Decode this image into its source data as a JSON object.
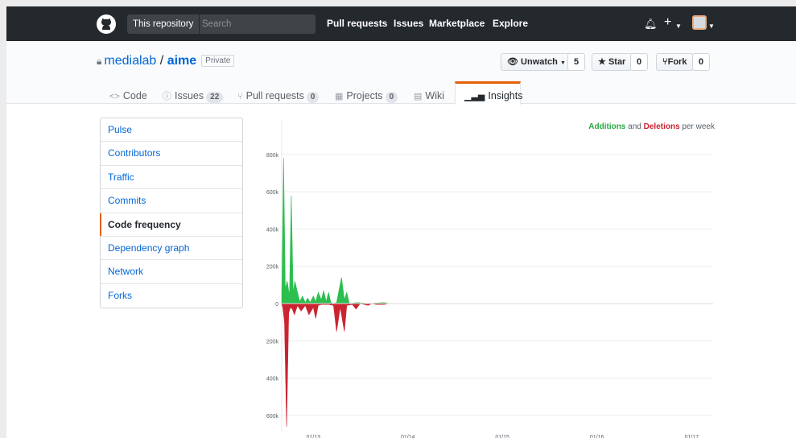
{
  "header": {
    "search_scope": "This repository",
    "search_placeholder": "Search",
    "nav": [
      "Pull requests",
      "Issues",
      "Marketplace",
      "Explore"
    ]
  },
  "repo": {
    "owner": "medialab",
    "separator": "/",
    "name": "aime",
    "visibility": "Private",
    "unwatch_label": "Unwatch",
    "watch_count": "5",
    "star_label": "Star",
    "star_count": "0",
    "fork_label": "Fork",
    "fork_count": "0"
  },
  "tabs": [
    {
      "label": "Code",
      "count": ""
    },
    {
      "label": "Issues",
      "count": "22"
    },
    {
      "label": "Pull requests",
      "count": "0"
    },
    {
      "label": "Projects",
      "count": "0"
    },
    {
      "label": "Wiki",
      "count": ""
    },
    {
      "label": "Insights",
      "count": "",
      "active": true
    }
  ],
  "sidebar": {
    "items": [
      "Pulse",
      "Contributors",
      "Traffic",
      "Commits",
      "Code frequency",
      "Dependency graph",
      "Network",
      "Forks"
    ],
    "selected": "Code frequency"
  },
  "legend": {
    "additions": "Additions",
    "and": "and",
    "deletions": "Deletions",
    "suffix": "per week"
  },
  "colors": {
    "additions": "#2cbe4e",
    "deletions": "#cb2431",
    "accent": "#e36209",
    "link": "#0366d6"
  },
  "chart_data": {
    "type": "area",
    "ytick_labels": [
      "800k",
      "600k",
      "400k",
      "200k",
      "0",
      "200k",
      "400k",
      "600k"
    ],
    "ytick_values": [
      800000,
      600000,
      400000,
      200000,
      0,
      -200000,
      -400000,
      -600000
    ],
    "xtick_labels": [
      "01/13",
      "01/14",
      "01/15",
      "01/16",
      "01/17"
    ],
    "ylim": [
      -700000,
      850000
    ],
    "xlim": [
      "2012-09",
      "2017-05"
    ],
    "grid": true,
    "series": [
      {
        "name": "Additions",
        "points": [
          [
            "2012-09",
            0
          ],
          [
            "2012-09-08",
            780000
          ],
          [
            "2012-09-15",
            80000
          ],
          [
            "2012-09-22",
            120000
          ],
          [
            "2012-10-01",
            40000
          ],
          [
            "2012-10-08",
            580000
          ],
          [
            "2012-10-15",
            60000
          ],
          [
            "2012-10-22",
            120000
          ],
          [
            "2012-11-01",
            60000
          ],
          [
            "2012-11-10",
            10000
          ],
          [
            "2012-11-20",
            40000
          ],
          [
            "2012-12-01",
            5000
          ],
          [
            "2012-12-10",
            30000
          ],
          [
            "2012-12-20",
            5000
          ],
          [
            "2013-01-01",
            40000
          ],
          [
            "2013-01-10",
            10000
          ],
          [
            "2013-01-20",
            60000
          ],
          [
            "2013-02-01",
            20000
          ],
          [
            "2013-02-10",
            70000
          ],
          [
            "2013-02-20",
            10000
          ],
          [
            "2013-03-01",
            60000
          ],
          [
            "2013-03-10",
            5000
          ],
          [
            "2013-03-20",
            0
          ],
          [
            "2013-04-01",
            5000
          ],
          [
            "2013-04-20",
            140000
          ],
          [
            "2013-05-01",
            20000
          ],
          [
            "2013-05-10",
            60000
          ],
          [
            "2013-05-20",
            0
          ],
          [
            "2013-06-20",
            5000
          ],
          [
            "2013-08-01",
            0
          ],
          [
            "2013-10-01",
            5000
          ],
          [
            "2013-10-20",
            0
          ]
        ]
      },
      {
        "name": "Deletions",
        "points": [
          [
            "2012-09",
            0
          ],
          [
            "2012-09-05",
            -20000
          ],
          [
            "2012-09-12",
            -100000
          ],
          [
            "2012-09-20",
            -660000
          ],
          [
            "2012-09-28",
            -50000
          ],
          [
            "2012-10-05",
            -20000
          ],
          [
            "2012-10-12",
            -30000
          ],
          [
            "2012-10-20",
            -60000
          ],
          [
            "2012-11-01",
            -10000
          ],
          [
            "2012-11-15",
            -40000
          ],
          [
            "2012-12-01",
            -10000
          ],
          [
            "2012-12-15",
            -60000
          ],
          [
            "2013-01-01",
            -20000
          ],
          [
            "2013-01-10",
            -80000
          ],
          [
            "2013-01-20",
            -10000
          ],
          [
            "2013-02-01",
            -5000
          ],
          [
            "2013-03-01",
            -5000
          ],
          [
            "2013-03-20",
            -10000
          ],
          [
            "2013-04-01",
            -150000
          ],
          [
            "2013-04-15",
            -20000
          ],
          [
            "2013-05-01",
            -150000
          ],
          [
            "2013-05-10",
            -10000
          ],
          [
            "2013-06-01",
            -5000
          ],
          [
            "2013-06-15",
            -30000
          ],
          [
            "2013-07-01",
            0
          ],
          [
            "2013-08-01",
            -10000
          ],
          [
            "2013-08-15",
            0
          ],
          [
            "2013-09-01",
            -5000
          ],
          [
            "2013-10-01",
            -5000
          ],
          [
            "2013-10-20",
            0
          ]
        ]
      }
    ]
  }
}
